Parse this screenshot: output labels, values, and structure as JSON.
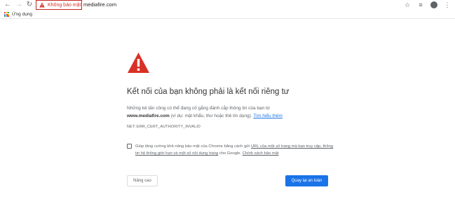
{
  "toolbar": {
    "back_icon": "arrow-left-icon",
    "forward_icon": "arrow-right-icon",
    "reload_icon": "reload-icon",
    "security_label": "Không bảo mật",
    "url": "mediafire.com",
    "right_icons": [
      "star-icon",
      "extension-icon",
      "profile-icon",
      "more-icon"
    ]
  },
  "bookmarks": {
    "apps_label": "Ứng dụng"
  },
  "interstitial": {
    "heading": "Kết nối của bạn không phải là kết nối riêng tư",
    "para_line1": "Những kẻ tấn công có thể đang cố gắng đánh cắp thông tin của bạn từ",
    "para_domain": "www.mediafire.com",
    "para_rest": " (ví dụ: mật khẩu, thư hoặc thẻ tín dụng). ",
    "learn_more": "Tìm hiểu thêm",
    "error_code": "NET::ERR_CERT_AUTHORITY_INVALID",
    "consent_pre": "Giúp tăng cường khả năng bảo mật của Chrome bằng cách gửi ",
    "consent_link1": "URL của một số trang mà bạn truy cập, thông tin hệ thống giới hạn và một số nội dung trang",
    "consent_mid": " cho Google. ",
    "consent_link2": "Chính sách bảo mật",
    "advanced_button": "Nâng cao",
    "back_button": "Quay lại an toàn"
  },
  "colors": {
    "accent": "#1a73e8",
    "warning": "#d93025"
  }
}
